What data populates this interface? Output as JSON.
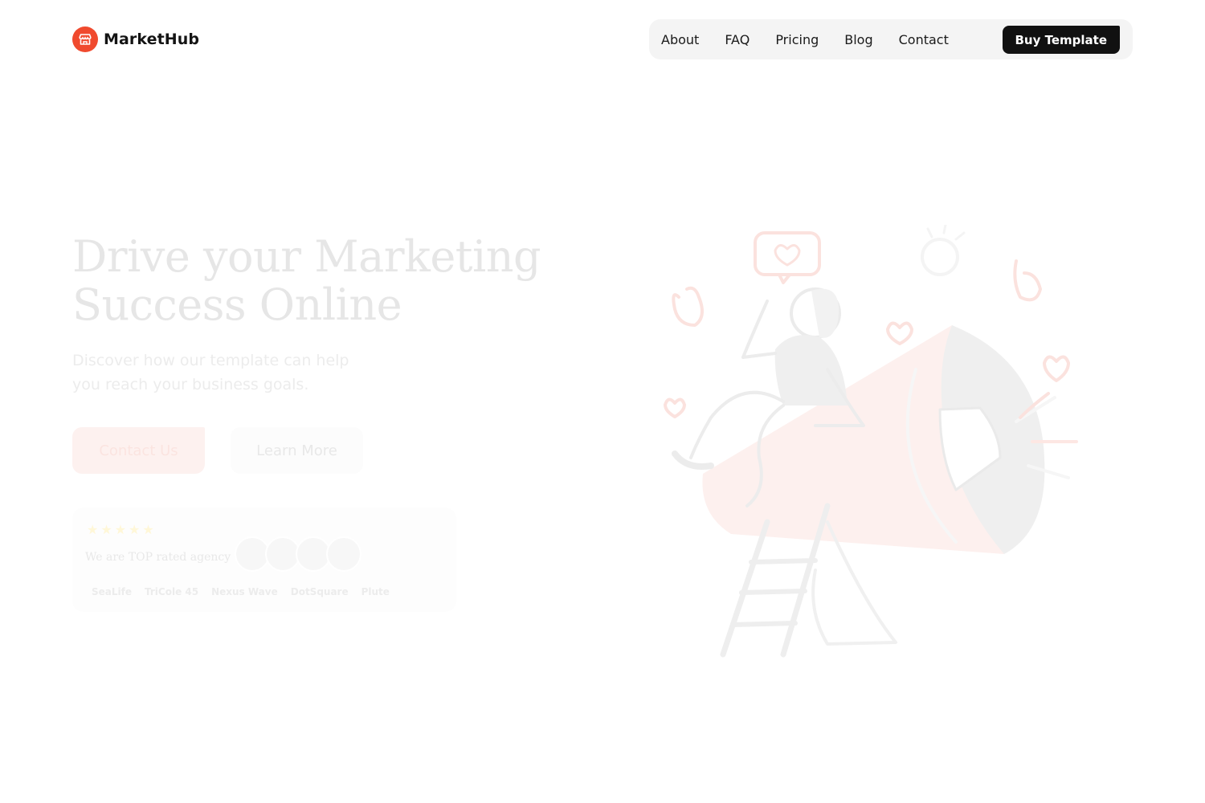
{
  "brand": {
    "name": "MarketHub",
    "icon": "storefront-icon",
    "color": "#f04a2e"
  },
  "nav": {
    "links": [
      "About",
      "FAQ",
      "Pricing",
      "Blog",
      "Contact"
    ],
    "cta": "Buy Template"
  },
  "hero": {
    "title_part1": "Drive your ",
    "title_highlight": "Marketing",
    "title_line2": "Success Online",
    "subtitle": "Discover how our template can help you reach your business goals.",
    "primary_button": "Contact Us",
    "secondary_button": "Learn More"
  },
  "rating": {
    "stars": "★★★★★",
    "text": "We are TOP rated agency",
    "brands": [
      "SeaLife",
      "TriCole 45",
      "Nexus Wave",
      "DotSquare",
      "Plute"
    ]
  },
  "colors": {
    "accent": "#f04a2e",
    "dark": "#111111",
    "nav_bg": "#f4f4f4"
  }
}
